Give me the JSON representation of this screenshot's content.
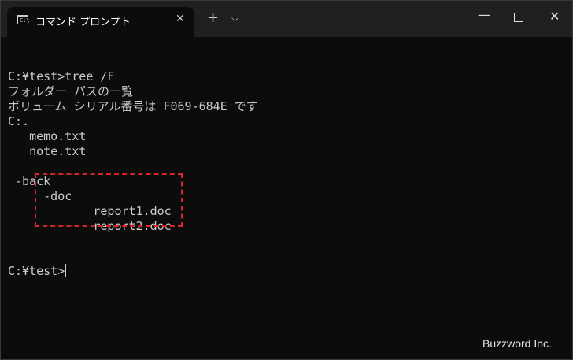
{
  "window": {
    "tab_title": "コマンド プロンプト",
    "tab_icon_glyph": "C:\\",
    "close_tab_glyph": "✕",
    "new_tab_glyph": "+",
    "dropdown_glyph": "⌵",
    "minimize_glyph": "—",
    "close_glyph": "✕"
  },
  "terminal": {
    "lines": [
      "",
      "C:¥test>tree /F",
      "フォルダー パスの一覧",
      "ボリューム シリアル番号は F069-684E です",
      "C:.",
      "   memo.txt",
      "   note.txt",
      "",
      " -back",
      "     -doc",
      "            report1.doc",
      "            report2.doc",
      "",
      "",
      "C:¥test>"
    ]
  },
  "annotation": {
    "highlight_color": "#d0262c"
  },
  "watermark": "Buzzword Inc."
}
